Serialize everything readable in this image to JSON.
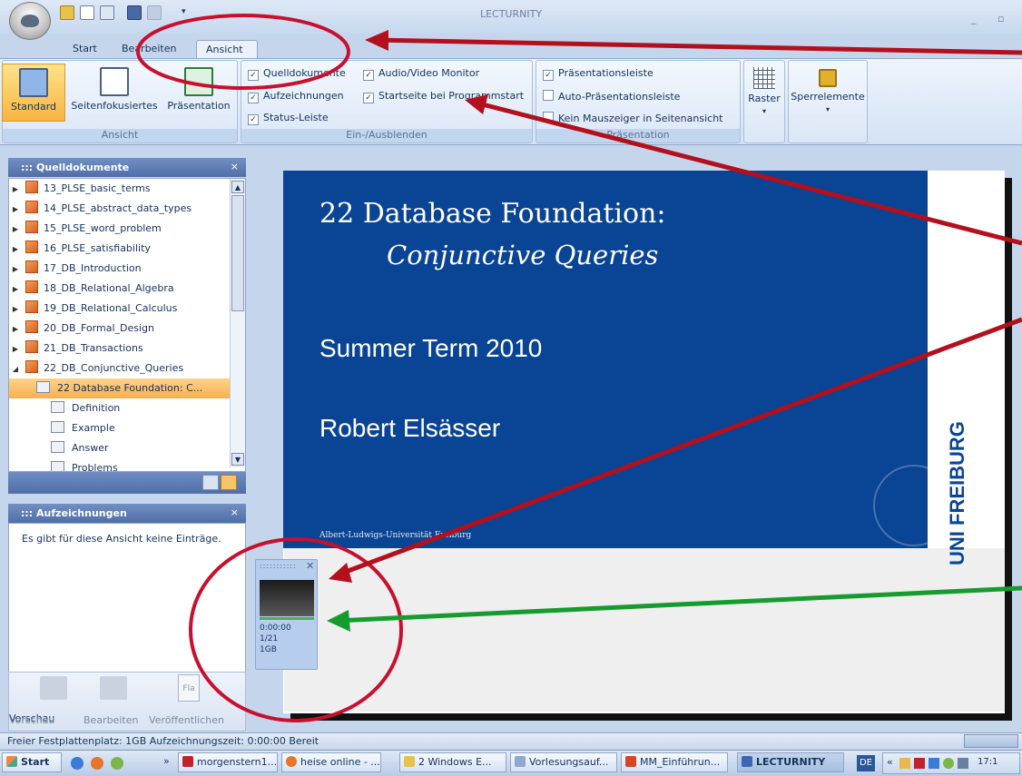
{
  "app": {
    "title": "LECTURNITY"
  },
  "tabs": [
    {
      "label": "Start"
    },
    {
      "label": "Bearbeiten"
    },
    {
      "label": "Ansicht"
    }
  ],
  "ribbon": {
    "ansicht": {
      "buttons": [
        "Standard",
        "Seitenfokusiertes",
        "Präsentation"
      ],
      "group_label": "Ansicht"
    },
    "ein_ausblenden": {
      "checkboxes": [
        {
          "label": "Quelldokumente",
          "checked": true
        },
        {
          "label": "Audio/Video Monitor",
          "checked": true
        },
        {
          "label": "Aufzeichnungen",
          "checked": true
        },
        {
          "label": "Startseite bei Programmstart",
          "checked": true
        },
        {
          "label": "Status-Leiste",
          "checked": true
        }
      ],
      "group_label": "Ein-/Ausblenden"
    },
    "praesentation": {
      "checkboxes": [
        {
          "label": "Präsentationsleiste",
          "checked": true
        },
        {
          "label": "Auto-Präsentationsleiste",
          "checked": false
        },
        {
          "label": "Kein Mauszeiger in Seitenansicht",
          "checked": false
        }
      ],
      "group_label": "Präsentation"
    },
    "raster_label": "Raster",
    "sperrelemente_label": "Sperrelemente"
  },
  "quelldokumente": {
    "title": "::: Quelldokumente",
    "items": [
      {
        "label": "13_PLSE_basic_terms"
      },
      {
        "label": "14_PLSE_abstract_data_types"
      },
      {
        "label": "15_PLSE_word_problem"
      },
      {
        "label": "16_PLSE_satisfiability"
      },
      {
        "label": "17_DB_Introduction"
      },
      {
        "label": "18_DB_Relational_Algebra"
      },
      {
        "label": "19_DB_Relational_Calculus"
      },
      {
        "label": "20_DB_Formal_Design"
      },
      {
        "label": "21_DB_Transactions"
      },
      {
        "label": "22_DB_Conjunctive_Queries"
      }
    ],
    "children": [
      {
        "label": "22 Database Foundation: C..."
      },
      {
        "label": "Definition"
      },
      {
        "label": "Example"
      },
      {
        "label": "Answer"
      },
      {
        "label": "Problems"
      }
    ]
  },
  "aufzeichnungen": {
    "title": "::: Aufzeichnungen",
    "empty_text": "Es gibt für diese Ansicht keine Einträge."
  },
  "bottom_actions": [
    "Vorschau",
    "Bearbeiten",
    "Veröffentlichen"
  ],
  "fla_label": "Fla",
  "slide": {
    "number": "22",
    "title": "Database Foundation:",
    "subtitle": "Conjunctive Queries",
    "term": "Summer Term 2010",
    "author": "Robert Elsässer",
    "footer": "Albert-Ludwigs-Universität Freiburg",
    "logo_text": "UNI FREIBURG"
  },
  "av_monitor": {
    "time": "0:00:00",
    "page": "1/21",
    "disk": "1GB"
  },
  "status": {
    "text": "Freier Festplattenplatz: 1GB   Aufzeichnungszeit: 0:00:00  Bereit"
  },
  "taskbar": {
    "start": "Start",
    "items": [
      "morgenstern1...",
      "heise online - ...",
      "2 Windows E...",
      "Vorlesungsauf...",
      "MM_Einführun...",
      "LECTURNITY"
    ],
    "lang": "DE",
    "time": "17:1"
  }
}
